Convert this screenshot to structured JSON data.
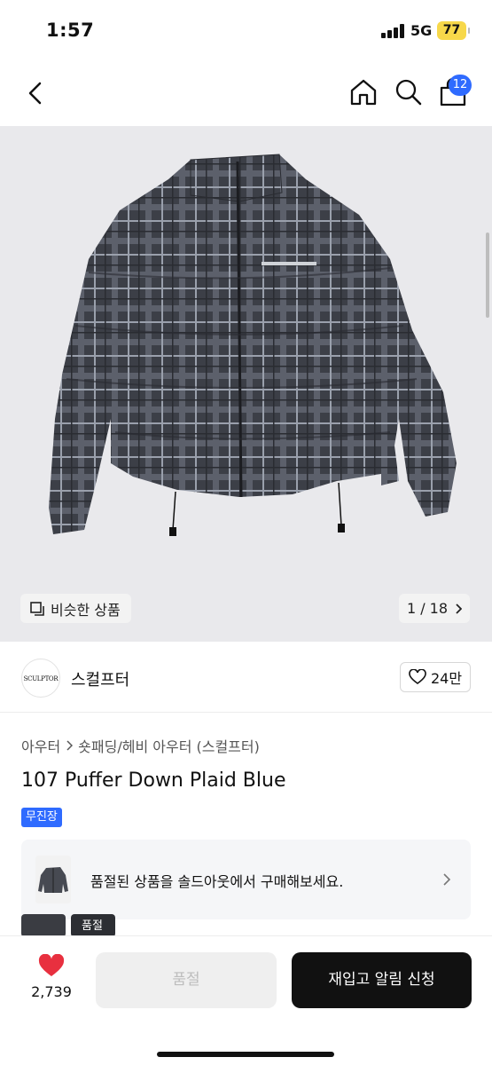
{
  "status_bar": {
    "time": "1:57",
    "network": "5G",
    "battery": "77"
  },
  "nav": {
    "cart_count": "12"
  },
  "gallery": {
    "similar_label": "비슷한 상품",
    "page_indicator": "1 / 18"
  },
  "brand": {
    "logo_text": "SCULPTOR",
    "name": "스컬프터",
    "likes": "24만"
  },
  "product": {
    "breadcrumb": [
      "아우터",
      "숏패딩/헤비 아우터 (스컬프터)"
    ],
    "title": "107 Puffer Down Plaid Blue",
    "tag": "무진장"
  },
  "sold_out_card": {
    "text": "품절된 상품을 솔드아웃에서 구매해보세요."
  },
  "thumbnails": {
    "sold_label": "품절"
  },
  "bottom_bar": {
    "fav_count": "2,739",
    "sold_button": "품절",
    "notify_button": "재입고 알림 신청"
  },
  "colors": {
    "accent": "#2f6bff",
    "heart": "#e8303f",
    "primary_button": "#111111"
  },
  "icons": [
    "back-arrow-icon",
    "home-icon",
    "search-icon",
    "cart-icon",
    "copy-icon",
    "chevron-right-icon",
    "heart-outline-icon",
    "heart-filled-icon"
  ]
}
